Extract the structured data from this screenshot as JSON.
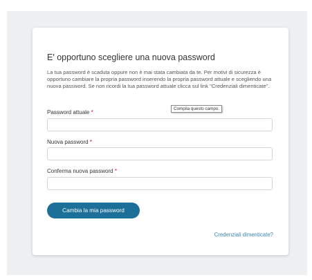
{
  "form": {
    "title": "E' opportuno scegliere una nuova password",
    "description": "La tua password è scaduta oppure non è mai stata cambiata da te. Per motivi di sicurezza è opportuno cambiare la propria password inserendo la propria password attuale e scegliendo una nuova password. Se non ricordi la tua password attuale clicca sul link \"Credenziali dimenticate\".",
    "required_marker": "*",
    "fields": [
      {
        "label": "Password attuale",
        "value": ""
      },
      {
        "label": "Nuova password",
        "value": ""
      },
      {
        "label": "Conferma nuova password",
        "value": ""
      }
    ],
    "validation_tooltip": "Compila questo campo.",
    "submit_label": "Cambia la mia password",
    "forgot_link": "Credenziali dimenticate?"
  },
  "colors": {
    "primary_button": "#1b6f98",
    "link": "#3a86b4",
    "required": "#d0021b",
    "page_background": "#eef0f2"
  }
}
